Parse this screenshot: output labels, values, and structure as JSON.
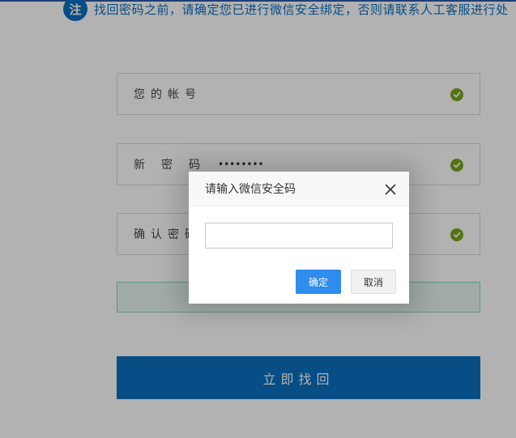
{
  "notice": {
    "icon_char": "注",
    "text": "找回密码之前，请确定您已进行微信安全绑定，否则请联系人工客服进行处"
  },
  "form": {
    "fields": [
      {
        "label": "您的帐号",
        "value": ""
      },
      {
        "label": "新密码",
        "value": "••••••••"
      },
      {
        "label": "确认密码",
        "value": ""
      }
    ],
    "submit_label": "立即找回"
  },
  "dialog": {
    "title": "请输入微信安全码",
    "input_value": "",
    "confirm_label": "确定",
    "cancel_label": "取消"
  },
  "colors": {
    "primary": "#0b6fc1",
    "check": "#7aa51a",
    "dialog_confirm": "#2e8ded"
  }
}
